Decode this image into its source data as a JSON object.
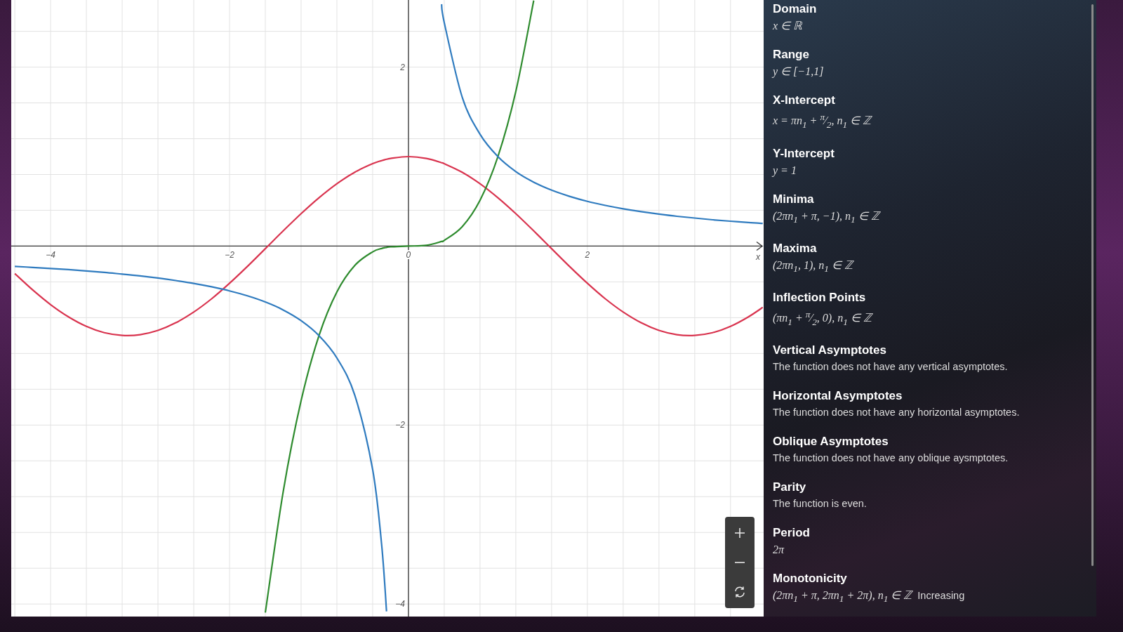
{
  "graph": {
    "chart_data": {
      "type": "line",
      "grid": true,
      "xlabel": "x",
      "xlim": [
        -4.44,
        3.97
      ],
      "ylim": [
        -4.14,
        2.75
      ],
      "xticks": [
        -4,
        -2,
        0,
        2
      ],
      "yticks": [
        -4,
        -2,
        2
      ],
      "x": [
        -4.4,
        -4.2,
        -4.0,
        -3.8,
        -3.6,
        -3.4,
        -3.2,
        -3.0,
        -2.8,
        -2.6,
        -2.4,
        -2.2,
        -2.0,
        -1.8,
        -1.6,
        -1.4,
        -1.2,
        -1.0,
        -0.8,
        -0.6,
        -0.4,
        -0.3,
        -0.245,
        -0.2,
        0,
        0.2,
        0.37,
        0.4,
        0.6,
        0.8,
        1.0,
        1.2,
        1.4,
        1.6,
        1.8,
        2.0,
        2.2,
        2.4,
        2.6,
        2.8,
        3.0,
        3.2,
        3.4,
        3.6,
        3.8,
        3.96
      ],
      "series": [
        {
          "color": "#d9344f",
          "values": [
            -0.307,
            -0.49,
            -0.654,
            -0.791,
            -0.897,
            -0.967,
            -0.998,
            -0.99,
            -0.942,
            -0.857,
            -0.737,
            -0.589,
            -0.416,
            -0.227,
            -0.029,
            0.17,
            0.362,
            0.54,
            0.697,
            0.825,
            0.921,
            0.955,
            0.97,
            0.98,
            1,
            0.98,
            0.932,
            0.921,
            0.825,
            0.697,
            0.54,
            0.362,
            0.17,
            -0.029,
            -0.227,
            -0.416,
            -0.589,
            -0.737,
            -0.857,
            -0.942,
            -0.99,
            -0.998,
            -0.967,
            -0.897,
            -0.791,
            -0.685
          ]
        },
        {
          "color": "#2e8b2e",
          "values": [
            null,
            null,
            null,
            null,
            null,
            null,
            null,
            null,
            null,
            null,
            null,
            null,
            null,
            null,
            -4.096,
            -2.744,
            -1.728,
            -1,
            -0.512,
            -0.216,
            -0.064,
            -0.027,
            -0.015,
            -0.008,
            0,
            0.008,
            0.051,
            0.064,
            0.216,
            0.512,
            1,
            1.728,
            2.744,
            null,
            null,
            null,
            null,
            null,
            null,
            null,
            null,
            null,
            null,
            null,
            null,
            null
          ]
        },
        {
          "color": "#2f7bbf",
          "values": [
            -0.227,
            -0.238,
            -0.25,
            -0.263,
            -0.278,
            -0.294,
            -0.313,
            -0.333,
            -0.357,
            -0.385,
            -0.417,
            -0.455,
            -0.5,
            -0.556,
            -0.625,
            -0.714,
            -0.833,
            -1,
            -1.25,
            -1.667,
            -2.5,
            -3.333,
            -4.082,
            null,
            null,
            null,
            2.703,
            2.5,
            1.667,
            1.25,
            1,
            0.833,
            0.714,
            0.625,
            0.556,
            0.5,
            0.455,
            0.417,
            0.385,
            0.357,
            0.333,
            0.313,
            0.294,
            0.278,
            0.263,
            0.253
          ]
        }
      ]
    }
  },
  "analysis": {
    "items": [
      {
        "title": "Domain",
        "kind": "math",
        "value": "x ∈ ℝ"
      },
      {
        "title": "Range",
        "kind": "math",
        "value": "y ∈ [−1,1]"
      },
      {
        "title": "X-Intercept",
        "kind": "math",
        "value": "x = πn$_{1}$ + $^{π}$⁄$_{2}$, n$_{1}$ ∈ ℤ"
      },
      {
        "title": "Y-Intercept",
        "kind": "math",
        "value": "y = 1"
      },
      {
        "title": "Minima",
        "kind": "math",
        "value": "(2πn$_{1}$ + π, −1), n$_{1}$ ∈ ℤ"
      },
      {
        "title": "Maxima",
        "kind": "math",
        "value": "(2πn$_{1}$, 1), n$_{1}$ ∈ ℤ"
      },
      {
        "title": "Inflection Points",
        "kind": "math",
        "value": "(πn$_{1}$ + $^{π}$⁄$_{2}$, 0), n$_{1}$ ∈ ℤ"
      },
      {
        "title": "Vertical Asymptotes",
        "kind": "text",
        "value": "The function does not have any vertical asymptotes."
      },
      {
        "title": "Horizontal Asymptotes",
        "kind": "text",
        "value": "The function does not have any horizontal asymptotes."
      },
      {
        "title": "Oblique Asymptotes",
        "kind": "text",
        "value": "The function does not have any oblique aysmptotes."
      },
      {
        "title": "Parity",
        "kind": "text",
        "value": "The function is even."
      },
      {
        "title": "Period",
        "kind": "math",
        "value": "2π"
      },
      {
        "title": "Monotonicity",
        "kind": "math",
        "value": "(2πn$_{1}$ + π, 2πn$_{1}$ + 2π), n$_{1}$ ∈ ℤ",
        "note": "Increasing"
      }
    ]
  }
}
